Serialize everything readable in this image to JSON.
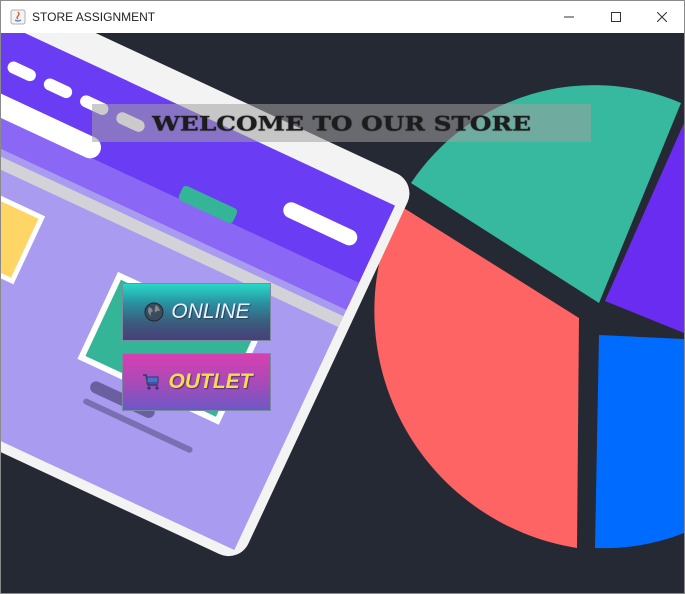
{
  "window": {
    "title": "STORE ASSIGNMENT",
    "controls": [
      "minimize-icon",
      "maximize-icon",
      "close-icon"
    ]
  },
  "banner": {
    "text": "WELCOME TO OUR STORE"
  },
  "buttons": {
    "online": {
      "label": "ONLINE",
      "icon": "globe-icon"
    },
    "outlet": {
      "label": "OUTLET",
      "icon": "shopping-cart-icon"
    }
  },
  "colors": {
    "background": "#252933",
    "pie_teal": "#37b99f",
    "pie_coral": "#ff6464",
    "pie_blue": "#006cff",
    "pie_purple": "#6a2cf0",
    "screen_purple": "#6a3cf3"
  }
}
